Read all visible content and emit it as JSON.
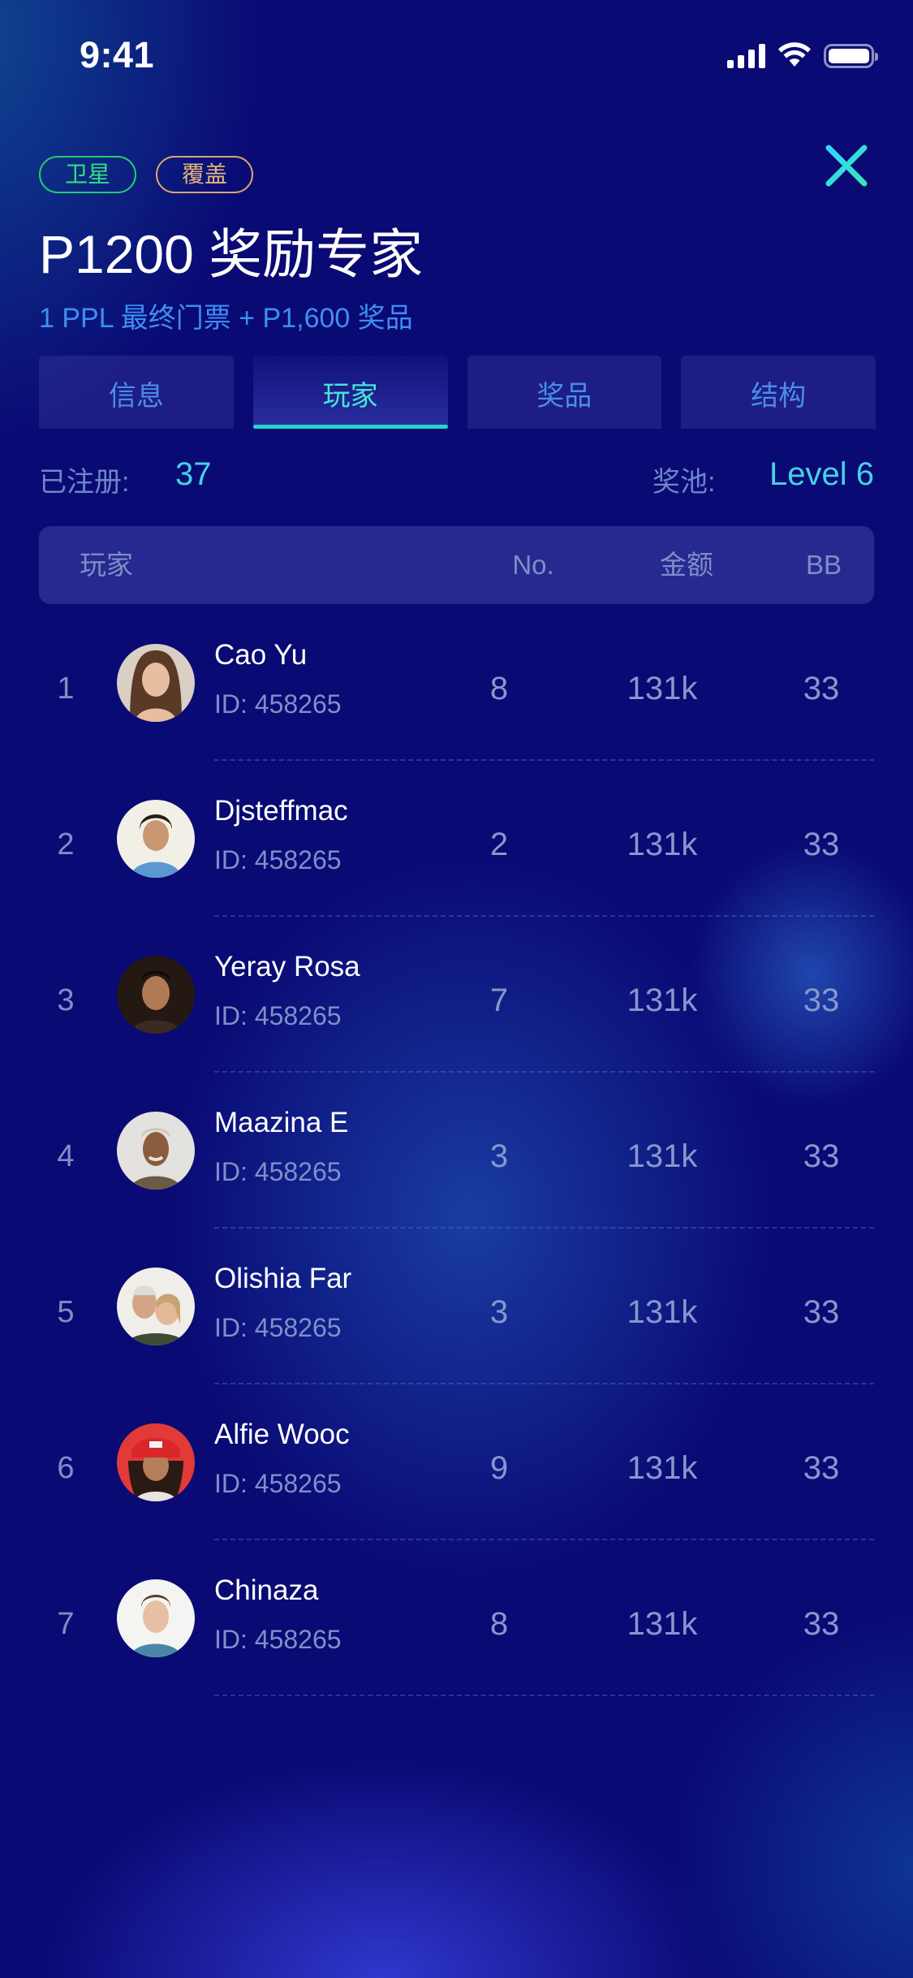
{
  "status_bar": {
    "time": "9:41"
  },
  "header": {
    "tags": [
      {
        "label": "卫星",
        "color": "#30e07c"
      },
      {
        "label": "覆盖",
        "color": "#e6b47a"
      }
    ],
    "title": "P1200 奖励专家",
    "subtitle": "1 PPL 最终门票 + P1,600 奖品",
    "close_icon": "close-x-icon"
  },
  "tabs": [
    {
      "label": "信息",
      "active": false
    },
    {
      "label": "玩家",
      "active": true
    },
    {
      "label": "奖品",
      "active": false
    },
    {
      "label": "结构",
      "active": false
    }
  ],
  "summary": {
    "registered_label": "已注册:",
    "registered_value": "37",
    "pool_label": "奖池:",
    "pool_value": "Level 6"
  },
  "table": {
    "headers": {
      "player": "玩家",
      "no": "No.",
      "amount": "金额",
      "bb": "BB"
    },
    "rows": [
      {
        "rank": "1",
        "name": "Cao Yu",
        "id": "ID: 458265",
        "no": "8",
        "amount": "131k",
        "bb": "33"
      },
      {
        "rank": "2",
        "name": "Djsteffmac",
        "id": "ID: 458265",
        "no": "2",
        "amount": "131k",
        "bb": "33"
      },
      {
        "rank": "3",
        "name": "Yeray Rosa",
        "id": "ID: 458265",
        "no": "7",
        "amount": "131k",
        "bb": "33"
      },
      {
        "rank": "4",
        "name": "Maazina E",
        "id": "ID: 458265",
        "no": "3",
        "amount": "131k",
        "bb": "33"
      },
      {
        "rank": "5",
        "name": "Olishia Far",
        "id": "ID: 458265",
        "no": "3",
        "amount": "131k",
        "bb": "33"
      },
      {
        "rank": "6",
        "name": "Alfie Wooc",
        "id": "ID: 458265",
        "no": "9",
        "amount": "131k",
        "bb": "33"
      },
      {
        "rank": "7",
        "name": "Chinaza",
        "id": "ID: 458265",
        "no": "8",
        "amount": "131k",
        "bb": "33"
      }
    ]
  },
  "colors": {
    "accent_teal": "#22d6c4",
    "link_blue": "#3e8ef0",
    "value_cyan": "#43d2e6",
    "background": "#0a0a74"
  }
}
